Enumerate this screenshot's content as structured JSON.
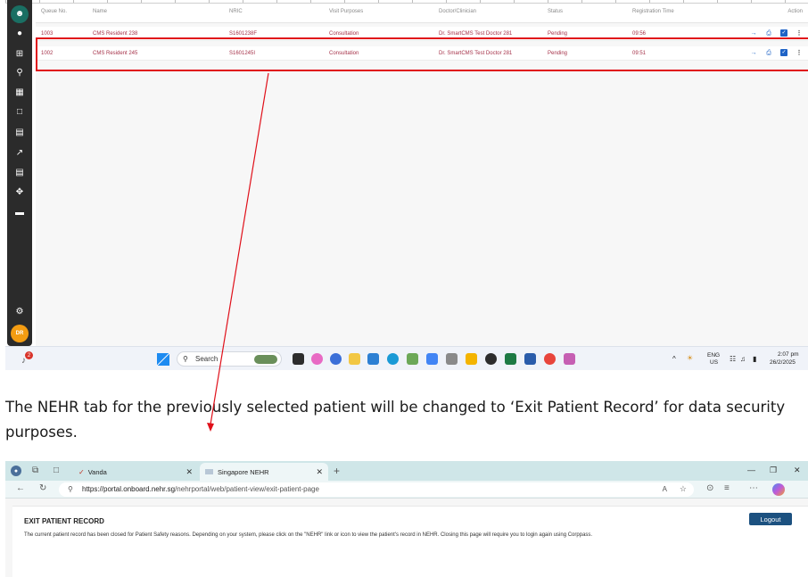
{
  "top_app": {
    "table": {
      "headers": [
        "Queue No.",
        "Name",
        "NRIC",
        "Visit Purposes",
        "Doctor/Clinician",
        "Status",
        "Registration Time",
        "Action"
      ],
      "rows": [
        {
          "queue": "1003",
          "name": "CMS Resident 238",
          "nric": "S1601238F",
          "purpose": "Consultation",
          "doctor": "Dr. SmartCMS Test Doctor 281",
          "status": "Pending",
          "time": "09:56"
        },
        {
          "queue": "1002",
          "name": "CMS Resident 245",
          "nric": "S1601245I",
          "purpose": "Consultation",
          "doctor": "Dr. SmartCMS Test Doctor 281",
          "status": "Pending",
          "time": "09:51"
        }
      ]
    },
    "avatar_initials": "DR",
    "colors": {
      "sidebar": "#2b2b2b",
      "active_icon": "#1a6f63",
      "row_text": "#a6334a",
      "highlight": "#e0101a",
      "action_blue": "#1e63c6"
    }
  },
  "taskbar": {
    "search_label": "Search",
    "notification_badge": "2",
    "lang": "ENG",
    "region": "US",
    "time": "2:07 pm",
    "date": "26/2/2025"
  },
  "caption": "The NEHR tab for the previously selected patient will be changed to ‘Exit Patient Record’ for data security purposes.",
  "browser": {
    "tabs": [
      {
        "label": "Vanda"
      },
      {
        "label": "Singapore NEHR"
      }
    ],
    "url_host": "https://portal.onboard.nehr.sg",
    "url_path": "/nehrportal/web/patient-view/exit-patient-page",
    "page": {
      "title": "EXIT PATIENT RECORD",
      "message": "The current patient record has been closed for Patient Safety reasons. Depending on your system, please click on the \"NEHR\" link or icon to view the patient's record in NEHR. Closing this page will require you to login again using Corppass.",
      "logout_label": "Logout"
    }
  }
}
